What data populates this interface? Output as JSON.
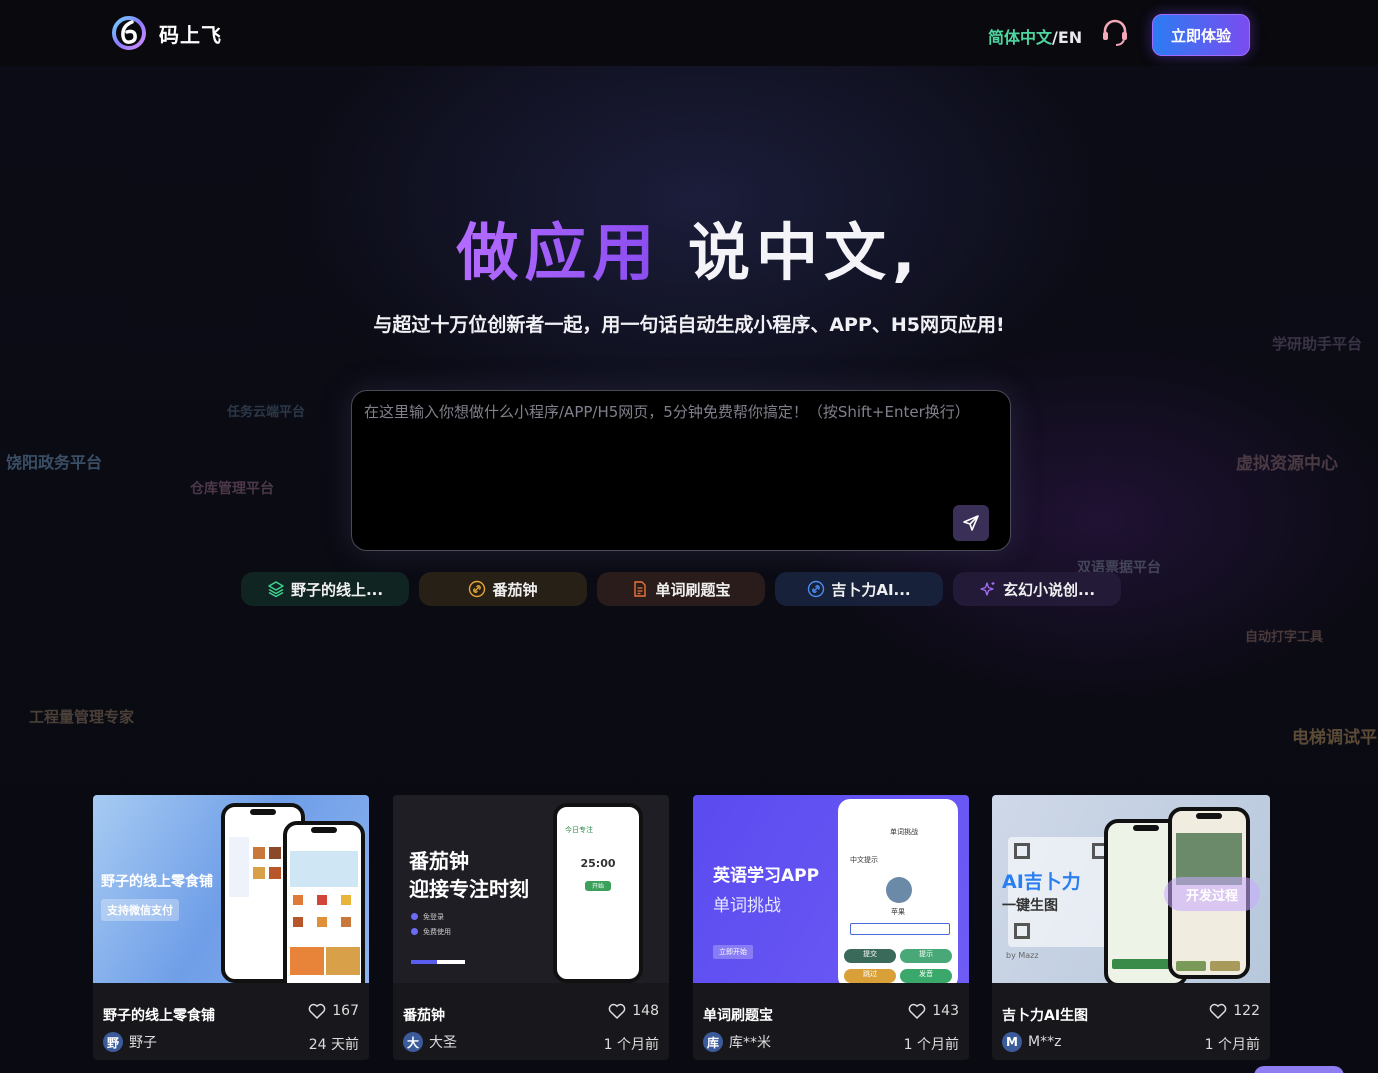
{
  "header": {
    "logo_text": "码上飞",
    "lang_zh": "简体中文",
    "lang_sep": "/",
    "lang_en": "EN",
    "cta_label": "立即体验"
  },
  "hero": {
    "title_accent": "做应用",
    "title_rest": " 说中文,",
    "subtitle": "与超过十万位创新者一起，用一句话自动生成小程序、APP、H5网页应用!"
  },
  "prompt": {
    "placeholder": "在这里输入你想做什么小程序/APP/H5网页，5分钟免费帮你搞定！（按Shift+Enter换行）"
  },
  "chips": [
    {
      "label": "野子的线上...",
      "icon": "layers-icon"
    },
    {
      "label": "番茄钟",
      "icon": "link-icon"
    },
    {
      "label": "单词刷题宝",
      "icon": "document-icon"
    },
    {
      "label": "吉卜力AI...",
      "icon": "link-icon"
    },
    {
      "label": "玄幻小说创...",
      "icon": "sparkle-icon"
    }
  ],
  "floating_tags": [
    {
      "text": "学研助手平台",
      "color": "#3a3346"
    },
    {
      "text": "任务云端平台",
      "color": "#2b3848"
    },
    {
      "text": "饶阳政务平台",
      "color": "#3a4f66"
    },
    {
      "text": "仓库管理平台",
      "color": "#4b3848"
    },
    {
      "text": "虚拟资源中心",
      "color": "#4a3a44"
    },
    {
      "text": "双语票据平台",
      "color": "#45455a"
    },
    {
      "text": "自动打字工具",
      "color": "#4a3a3a"
    },
    {
      "text": "工程量管理专家",
      "color": "#4a4038"
    },
    {
      "text": "电梯调试平",
      "color": "#5a4a36"
    }
  ],
  "cards": [
    {
      "title": "野子的线上零食铺",
      "likes": "167",
      "author": "野子",
      "avatar": "野",
      "time": "24 天前",
      "thumb_title": "野子的线上零食铺",
      "thumb_badge": "支持微信支付"
    },
    {
      "title": "番茄钟",
      "likes": "148",
      "author": "大圣",
      "avatar": "大",
      "time": "1 个月前",
      "thumb_title_1": "番茄钟",
      "thumb_title_2": "迎接专注时刻",
      "thumb_item_1": "免登录",
      "thumb_item_2": "免费使用",
      "thumb_timer": "25:00",
      "thumb_app": "今日专注",
      "thumb_btn": "开始"
    },
    {
      "title": "单词刷题宝",
      "likes": "143",
      "author": "库**米",
      "avatar": "库",
      "time": "1 个月前",
      "thumb_title_1": "英语学习APP",
      "thumb_title_2": "单词挑战",
      "thumb_btn": "立即开始",
      "thumb_screen_title": "单词挑战",
      "thumb_word": "苹果",
      "thumb_prompt": "中文提示",
      "thumb_b1": "提交",
      "thumb_b2": "提示",
      "thumb_b3": "跳过",
      "thumb_b4": "发音"
    },
    {
      "title": "吉卜力AI生图",
      "likes": "122",
      "author": "M**z",
      "avatar": "M",
      "time": "1 个月前",
      "thumb_title_1": "AI吉卜力",
      "thumb_title_2": "一键生图",
      "thumb_by": "by Mazz",
      "thumb_overlay": "开发过程"
    }
  ]
}
